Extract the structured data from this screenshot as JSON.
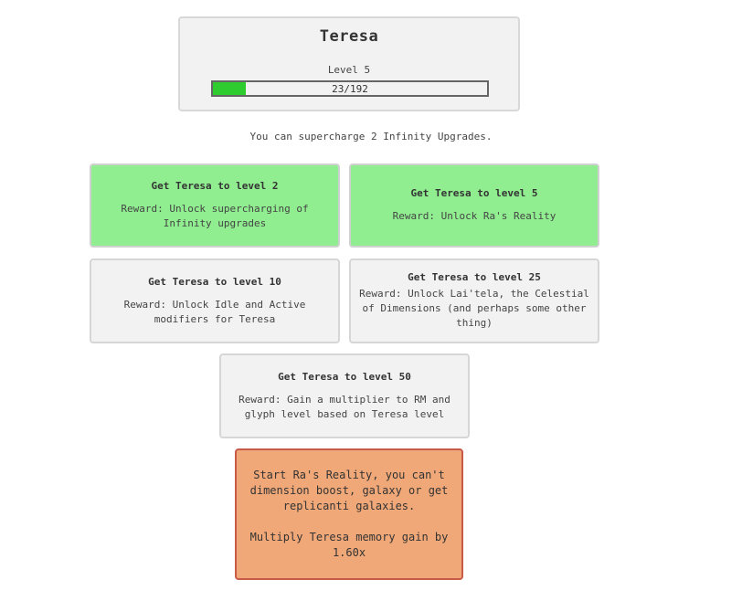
{
  "pet": {
    "name": "Teresa",
    "level_label": "Level 5",
    "xp_current": 23,
    "xp_max": 192,
    "xp_label": "23/192",
    "fill_color": "#2ecc2e"
  },
  "info": {
    "supercharge_text": "You can supercharge 2 Infinity Upgrades."
  },
  "unlocks": [
    {
      "title": "Get Teresa to level 2",
      "reward": "Reward: Unlock supercharging of Infinity upgrades",
      "unlocked": true
    },
    {
      "title": "Get Teresa to level 5",
      "reward": "Reward: Unlock Ra's Reality",
      "unlocked": true
    },
    {
      "title": "Get Teresa to level 10",
      "reward": "Reward: Unlock Idle and Active modifiers for Teresa",
      "unlocked": false
    },
    {
      "title": "Get Teresa to level 25",
      "reward": "Reward: Unlock Lai'tela, the Celestial of Dimensions (and perhaps some other thing)",
      "unlocked": false
    },
    {
      "title": "Get Teresa to level 50",
      "reward": "Reward: Gain a multiplier to RM and glyph level based on Teresa level",
      "unlocked": false
    }
  ],
  "start_reality": {
    "description": "Start Ra's Reality, you can't dimension boost, galaxy or get replicanti galaxies.",
    "multiplier": "Multiply Teresa memory gain by 1.60x"
  },
  "colors": {
    "unlocked_bg": "#90ee90",
    "locked_bg": "#f2f2f2",
    "start_bg": "#f0a878",
    "start_border": "#c85a4a"
  }
}
